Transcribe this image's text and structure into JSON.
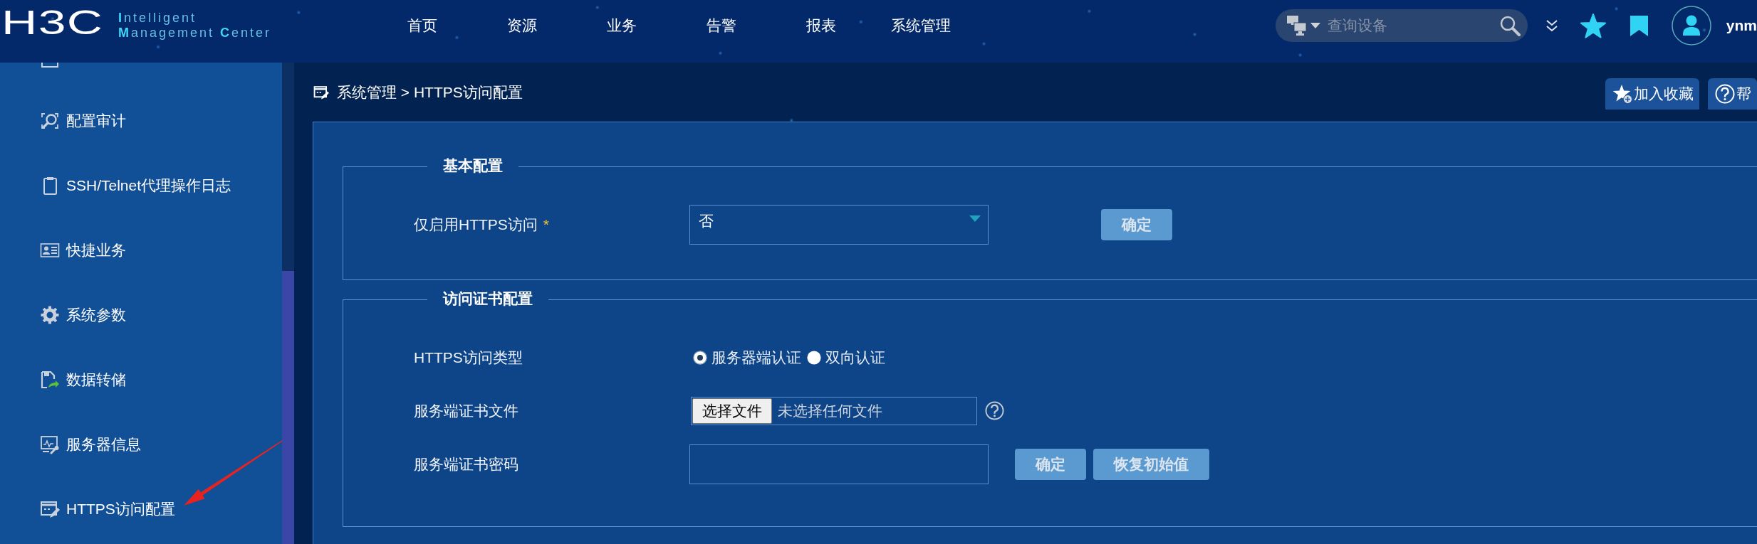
{
  "header": {
    "logo": "H3C",
    "tagline": [
      "**I**ntelligent",
      "**M**anagement **C**enter"
    ],
    "nav": [
      "首页",
      "资源",
      "业务",
      "告警",
      "报表",
      "系统管理"
    ],
    "search": {
      "placeholder": "查询设备"
    },
    "user": "ynm"
  },
  "sidebar": {
    "items": [
      "配置审计",
      "SSH/Telnet代理操作日志",
      "快捷业务",
      "系统参数",
      "数据转储",
      "服务器信息",
      "HTTPS访问配置"
    ]
  },
  "breadcrumb": "系统管理 > HTTPS访问配置",
  "page_actions": [
    "加入收藏",
    "帮"
  ],
  "sections": [
    {
      "title": "基本配置",
      "fields": [
        {
          "kind": "select",
          "label": "仅启用HTTPS访问",
          "required_mark": "*",
          "value": "否",
          "buttons": [
            "确定"
          ]
        }
      ]
    },
    {
      "title": "访问证书配置",
      "fields": [
        {
          "kind": "radio",
          "label": "HTTPS访问类型",
          "options": [
            {
              "label": "服务器端认证",
              "selected": true
            },
            {
              "label": "双向认证",
              "selected": false
            }
          ]
        },
        {
          "kind": "file",
          "label": "服务端证书文件",
          "button": "选择文件",
          "file_status": "未选择任何文件",
          "help": true
        },
        {
          "kind": "password",
          "label": "服务端证书密码",
          "buttons": [
            "确定",
            "恢复初始值"
          ]
        }
      ]
    }
  ]
}
